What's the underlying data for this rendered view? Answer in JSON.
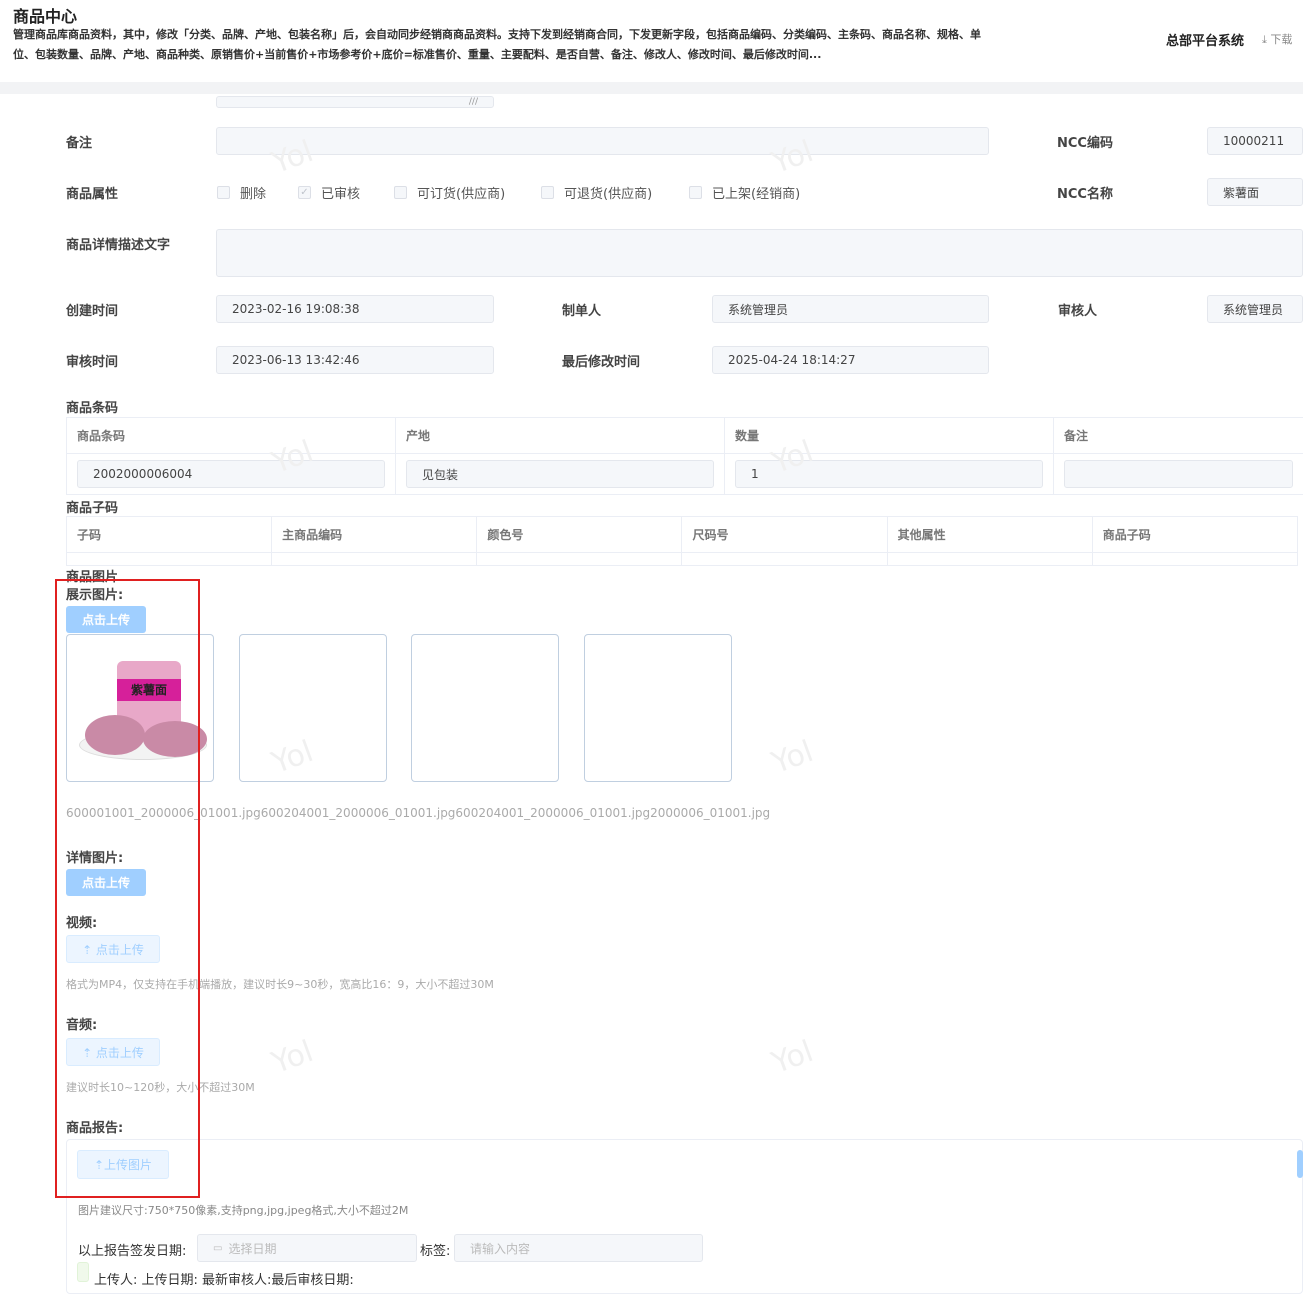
{
  "header": {
    "title": "商品中心",
    "description": "管理商品库商品资料，其中，修改「分类、品牌、产地、包装名称」后，会自动同步经销商商品资料。支持下发到经销商合同，下发更新字段，包括商品编码、分类编码、主条码、商品名称、规格、单位、包装数量、品牌、产地、商品种类、原销售价+当前售价+市场参考价+底价=标准售价、重量、主要配料、是否自营、备注、修改人、修改时间、最后修改时间...",
    "system": "总部平台系统",
    "download": "⤓ 下载"
  },
  "form": {
    "remark_label": "备注",
    "remark_value": "",
    "ncc_code_label": "NCC编码",
    "ncc_code_value": "10000211",
    "attr_label": "商品属性",
    "attrs": [
      {
        "label": "删除",
        "checked": false
      },
      {
        "label": "已审核",
        "checked": true
      },
      {
        "label": "可订货(供应商)",
        "checked": false
      },
      {
        "label": "可退货(供应商)",
        "checked": false
      },
      {
        "label": "已上架(经销商)",
        "checked": false
      }
    ],
    "ncc_name_label": "NCC名称",
    "ncc_name_value": "紫薯面",
    "detail_text_label": "商品详情描述文字",
    "created_label": "创建时间",
    "created_value": "2023-02-16 19:08:38",
    "maker_label": "制单人",
    "maker_value": "系统管理员",
    "auditor_label": "审核人",
    "auditor_value": "系统管理员",
    "audit_time_label": "审核时间",
    "audit_time_value": "2023-06-13 13:42:46",
    "modified_label": "最后修改时间",
    "modified_value": "2025-04-24 18:14:27"
  },
  "barcode": {
    "title": "商品条码",
    "columns": [
      "商品条码",
      "产地",
      "数量",
      "备注"
    ],
    "row": [
      "2002000006004",
      "见包装",
      "1",
      ""
    ]
  },
  "subcode": {
    "title": "商品子码",
    "columns": [
      "子码",
      "主商品编码",
      "颜色号",
      "尺码号",
      "其他属性",
      "商品子码"
    ]
  },
  "images": {
    "title": "商品图片",
    "display_label": "展示图片:",
    "upload": "点击上传",
    "filenames": "600001001_2000006_01001.jpg600204001_2000006_01001.jpg600204001_2000006_01001.jpg2000006_01001.jpg",
    "product_text": "紫薯面",
    "detail_label": "详情图片:",
    "video_label": "视频:",
    "upload_icon": "⇡ 点击上传",
    "video_hint": "格式为MP4，仅支持在手机端播放，建议时长9~30秒，宽高比16：9，大小不超过30M",
    "audio_label": "音频:",
    "audio_hint": "建议时长10~120秒，大小不超过30M"
  },
  "report": {
    "label": "商品报告:",
    "upload": "⇡上传图片",
    "hint": "图片建议尺寸:750*750像素,支持png,jpg,jpeg格式,大小不超过2M",
    "date_label": "以上报告签发日期:",
    "date_placeholder": "选择日期",
    "tag_label": "标签:",
    "tag_placeholder": "请输入内容",
    "meta": "上传人: 上传日期: 最新审核人:最后审核日期:"
  },
  "watermark": "Yol",
  "colors": {
    "accent": "#a0cfff",
    "highlight": "#e02020"
  }
}
